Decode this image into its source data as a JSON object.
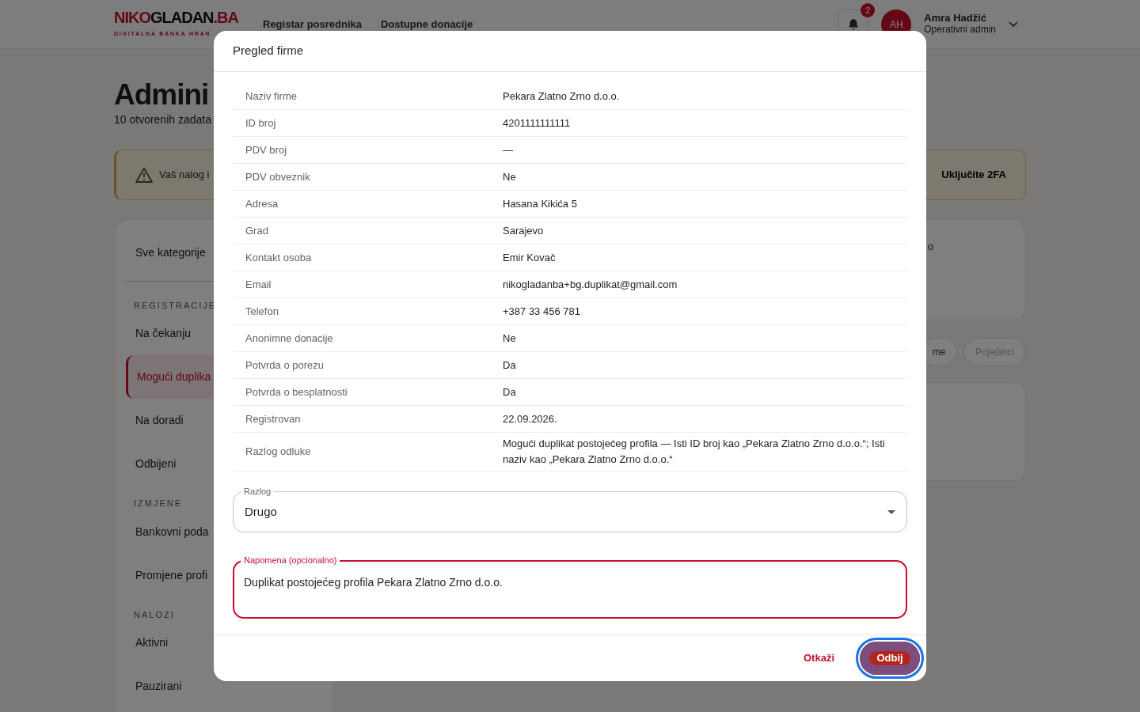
{
  "navbar": {
    "logo": {
      "part_1": "NIKO",
      "part_2": "GLADAN",
      "part_3": ".BA",
      "tagline": "DIGITALNA BANKA HRAN"
    },
    "links": [
      "Registar posrednika",
      "Dostupne donacije"
    ],
    "notifications": {
      "count": "2"
    },
    "user": {
      "initials": "AH",
      "name": "Amra Hadžić",
      "role": "Operativni admin"
    }
  },
  "page": {
    "title": "Admini",
    "subtitle": "10 otvorenih zadata",
    "alert": {
      "text": "Vaš nalog i",
      "action": "Uključite 2FA"
    },
    "card_text": "o",
    "filters": [
      {
        "label": "me",
        "selected": true
      },
      {
        "label": "Pojedinci",
        "selected": false
      }
    ]
  },
  "sidebar": {
    "top_item": {
      "label": "Sve kategorije",
      "selected": false
    },
    "groups": [
      {
        "heading": "REGISTRACIJE",
        "items": [
          {
            "label": "Na čekanju",
            "selected": false
          },
          {
            "label": "Mogući duplika",
            "selected": true
          },
          {
            "label": "Na doradi",
            "selected": false
          },
          {
            "label": "Odbijeni",
            "selected": false
          }
        ]
      },
      {
        "heading": "IZMJENE",
        "items": [
          {
            "label": "Bankovni poda",
            "selected": false
          },
          {
            "label": "Promjene profi",
            "selected": false
          }
        ]
      },
      {
        "heading": "NALOZI",
        "items": [
          {
            "label": "Aktivni",
            "selected": false
          },
          {
            "label": "Pauzirani",
            "selected": false
          }
        ]
      }
    ]
  },
  "modal": {
    "title": "Pregled firme",
    "details": [
      {
        "label": "Naziv firme",
        "value": "Pekara Zlatno Zrno d.o.o."
      },
      {
        "label": "ID broj",
        "value": "4201111111111"
      },
      {
        "label": "PDV broj",
        "value": "—"
      },
      {
        "label": "PDV obveznik",
        "value": "Ne"
      },
      {
        "label": "Adresa",
        "value": "Hasana Kikića 5"
      },
      {
        "label": "Grad",
        "value": "Sarajevo"
      },
      {
        "label": "Kontakt osoba",
        "value": "Emir Kovač"
      },
      {
        "label": "Email",
        "value": "nikogladanba+bg.duplikat@gmail.com"
      },
      {
        "label": "Telefon",
        "value": "+387 33 456 781"
      },
      {
        "label": "Anonimne donacije",
        "value": "Ne"
      },
      {
        "label": "Potvrda o porezu",
        "value": "Da"
      },
      {
        "label": "Potvrda o besplatnosti",
        "value": "Da"
      },
      {
        "label": "Registrovan",
        "value": "22.09.2026."
      },
      {
        "label": "Razlog odluke",
        "value": "Mogući duplikat postojećeg profila — Isti ID broj kao „Pekara Zlatno Zrno d.o.o.“; Isti naziv kao „Pekara Zlatno Zrno d.o.o.“"
      }
    ],
    "reason_select": {
      "label": "Razlog",
      "value": "Drugo"
    },
    "note_field": {
      "label": "Napomena (opcionalno)",
      "value": "Duplikat postojećeg profila Pekara Zlatno Zrno d.o.o.",
      "focused": true
    },
    "buttons": [
      {
        "kind": "link",
        "label": "Otkaži",
        "focused": false
      },
      {
        "kind": "danger",
        "label": "Odbij",
        "focused": true
      }
    ]
  }
}
